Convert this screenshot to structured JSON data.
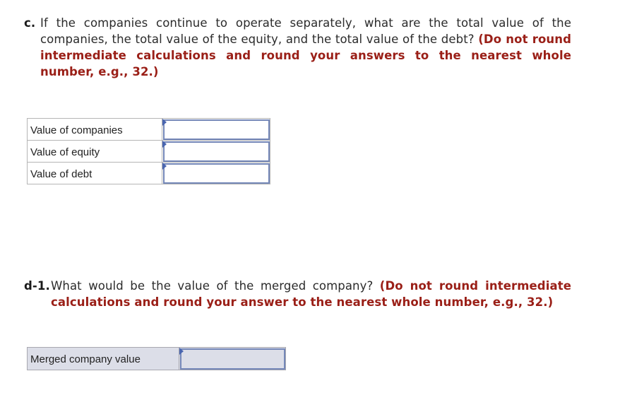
{
  "questions": {
    "c": {
      "label": "c.",
      "text": "If the companies continue to operate separately, what are the total value of the companies, the total value of the equity, and the total value of the debt? ",
      "instruction": "(Do not round intermediate calculations and round your answers to the nearest whole number, e.g., 32.)",
      "rows": [
        {
          "label": "Value of companies",
          "value": "",
          "flag_icon": "flag-icon"
        },
        {
          "label": "Value of equity",
          "value": "",
          "flag_icon": "flag-icon"
        },
        {
          "label": "Value of debt",
          "value": "",
          "flag_icon": "flag-icon"
        }
      ]
    },
    "d1": {
      "label": "d-1.",
      "text": "What would be the value of the merged company? ",
      "instruction": "(Do not round intermediate calculations and round your answer to the nearest whole number, e.g., 32.)",
      "rows": [
        {
          "label": "Merged company value",
          "value": "",
          "flag_icon": "flag-icon"
        }
      ]
    }
  },
  "colors": {
    "instruction_text": "#9a1f17",
    "input_border": "#7487b8",
    "flag": "#4a66b0",
    "highlight_row_bg": "#dcdee8"
  }
}
